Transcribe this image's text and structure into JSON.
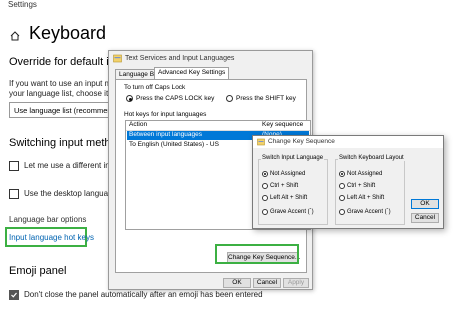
{
  "window": {
    "title": "Settings"
  },
  "page": {
    "title": "Keyboard"
  },
  "override": {
    "heading": "Override for default inp",
    "line1": "If you want to use an input meth",
    "line2": "your language list, choose it her",
    "select_value": "Use language list (recommenc"
  },
  "switching": {
    "heading": "Switching input metho",
    "option1": "Let me use a different inpu",
    "option2": "Use the desktop language b"
  },
  "language_bar": {
    "label": "Language bar options",
    "hotkeys_link": "Input language hot keys"
  },
  "emoji": {
    "heading": "Emoji panel",
    "option": "Don't close the panel automatically after an emoji has been entered"
  },
  "text_services_dialog": {
    "title": "Text Services and Input Languages",
    "tabs": [
      "Language Bar",
      "Advanced Key Settings"
    ],
    "caps_lock_label": "To turn off Caps Lock",
    "caps_options": [
      "Press the CAPS LOCK key",
      "Press the SHIFT key"
    ],
    "hotkeys_label": "Hot keys for input languages",
    "columns": [
      "Action",
      "Key sequence"
    ],
    "rows": [
      {
        "action": "Between input languages",
        "key": "(None)"
      },
      {
        "action": "To English (United States) - US",
        "key": ""
      }
    ],
    "change_button": "Change Key Sequence...",
    "buttons": [
      "OK",
      "Cancel",
      "Apply"
    ]
  },
  "change_key_dialog": {
    "title": "Change Key Sequence",
    "switch_input_label": "Switch Input Language",
    "switch_layout_label": "Switch Keyboard Layout",
    "options": [
      "Not Assigned",
      "Ctrl + Shift",
      "Left Alt + Shift",
      "Grave Accent (`)"
    ],
    "ok": "OK",
    "cancel": "Cancel"
  },
  "colors": {
    "highlight": "#3cb043",
    "selection": "#0078d7",
    "link": "#0063b1"
  }
}
